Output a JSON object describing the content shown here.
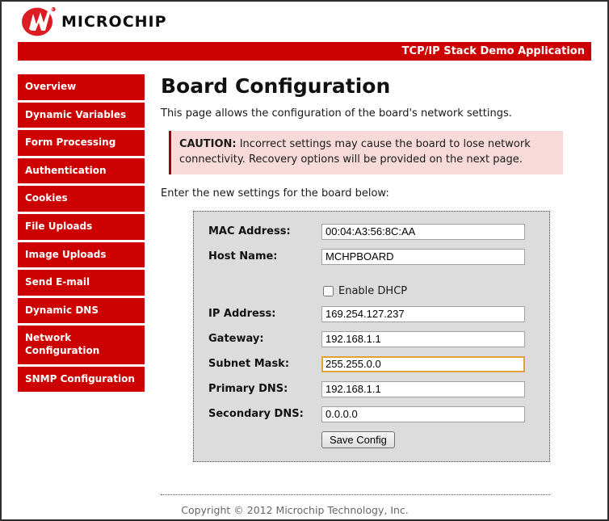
{
  "header": {
    "brand_text": "MICROCHIP",
    "titlebar_text": "TCP/IP Stack Demo Application"
  },
  "sidebar": {
    "items": [
      {
        "label": "Overview"
      },
      {
        "label": "Dynamic Variables"
      },
      {
        "label": "Form Processing"
      },
      {
        "label": "Authentication"
      },
      {
        "label": "Cookies"
      },
      {
        "label": "File Uploads"
      },
      {
        "label": "Image Uploads"
      },
      {
        "label": "Send E-mail"
      },
      {
        "label": "Dynamic DNS"
      },
      {
        "label": "Network Configuration"
      },
      {
        "label": "SNMP Configuration"
      }
    ]
  },
  "main": {
    "title": "Board Configuration",
    "intro": "This page allows the configuration of the board's network settings.",
    "caution_label": "CAUTION:",
    "caution_text": " Incorrect settings may cause the board to lose network connectivity. Recovery options will be provided on the next page.",
    "enter_text": "Enter the new settings for the board below:",
    "form": {
      "fields": [
        {
          "label": "MAC Address:",
          "value": "00:04:A3:56:8C:AA"
        },
        {
          "label": "Host Name:",
          "value": "MCHPBOARD"
        },
        {
          "label": "IP Address:",
          "value": "169.254.127.237"
        },
        {
          "label": "Gateway:",
          "value": "192.168.1.1"
        },
        {
          "label": "Subnet Mask:",
          "value": "255.255.0.0"
        },
        {
          "label": "Primary DNS:",
          "value": "192.168.1.1"
        },
        {
          "label": "Secondary DNS:",
          "value": "0.0.0.0"
        }
      ],
      "dhcp_label": "Enable DHCP",
      "dhcp_checked": false,
      "save_label": "Save Config"
    }
  },
  "footer": {
    "copyright": "Copyright © 2012 Microchip Technology, Inc."
  },
  "colors": {
    "brand_red": "#cc0000",
    "logo_red": "#dd1b23",
    "caution_bg": "#f8dada",
    "caution_border": "#990000",
    "focus_border": "#e2a23b",
    "form_bg": "#dcdcdc"
  }
}
